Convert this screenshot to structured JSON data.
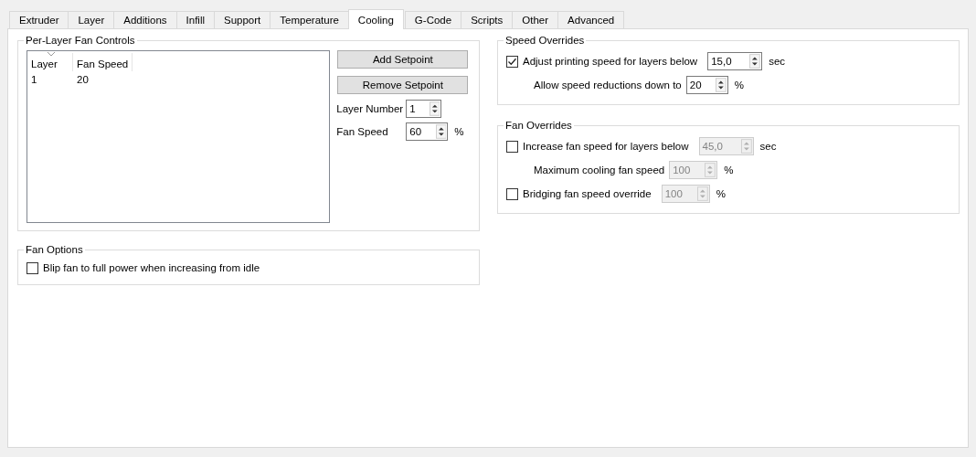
{
  "tabs": [
    {
      "label": "Extruder",
      "selected": false
    },
    {
      "label": "Layer",
      "selected": false
    },
    {
      "label": "Additions",
      "selected": false
    },
    {
      "label": "Infill",
      "selected": false
    },
    {
      "label": "Support",
      "selected": false
    },
    {
      "label": "Temperature",
      "selected": false
    },
    {
      "label": "Cooling",
      "selected": true
    },
    {
      "label": "G-Code",
      "selected": false
    },
    {
      "label": "Scripts",
      "selected": false
    },
    {
      "label": "Other",
      "selected": false
    },
    {
      "label": "Advanced",
      "selected": false
    }
  ],
  "per_layer_fan_controls": {
    "title": "Per-Layer Fan Controls",
    "columns": [
      "Layer",
      "Fan Speed"
    ],
    "rows": [
      [
        "1",
        "20"
      ]
    ],
    "buttons": [
      "Add Setpoint",
      "Remove Setpoint"
    ],
    "fields": [
      {
        "label": "Layer Number",
        "value": "1"
      },
      {
        "label": "Fan Speed",
        "value": "60",
        "unit": "%"
      }
    ]
  },
  "fan_options": {
    "title": "Fan Options",
    "options": [
      {
        "label": "Blip fan to full power when increasing from idle",
        "checked": false
      }
    ]
  },
  "speed_overrides": {
    "title": "Speed Overrides",
    "rows": [
      {
        "kind": "checkbox",
        "label": "Adjust printing speed for layers below",
        "checked": true,
        "value": "15,0",
        "unit": "sec",
        "disabled": false
      },
      {
        "kind": "field",
        "label": "Allow speed reductions down to",
        "value": "20",
        "unit": "%",
        "disabled": false
      }
    ]
  },
  "fan_overrides": {
    "title": "Fan Overrides",
    "rows": [
      {
        "kind": "checkbox",
        "label": "Increase fan speed for layers below",
        "checked": false,
        "value": "45,0",
        "unit": "sec",
        "disabled": true
      },
      {
        "kind": "field",
        "label": "Maximum cooling fan speed",
        "value": "100",
        "unit": "%",
        "disabled": true
      },
      {
        "kind": "checkbox",
        "label": "Bridging fan speed override",
        "checked": false,
        "value": "100",
        "unit": "%",
        "disabled": true
      }
    ]
  }
}
